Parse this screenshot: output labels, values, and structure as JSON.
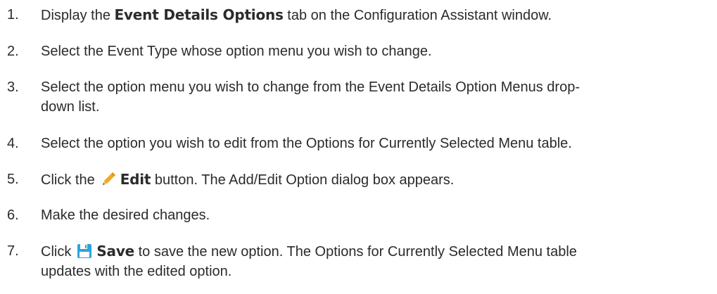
{
  "steps": [
    {
      "number": "1.",
      "before": "Display the ",
      "bold": "Event Details Options",
      "after": " tab on the Configuration Assistant window."
    },
    {
      "number": "2.",
      "text": "Select the Event Type whose option menu you wish to change."
    },
    {
      "number": "3.",
      "line1": "Select the option menu you wish to change from the Event Details Option Menus drop-",
      "line2": "down list."
    },
    {
      "number": "4.",
      "text": "Select the option you wish to edit from the Options for Currently Selected Menu table."
    },
    {
      "number": "5.",
      "before": "Click the",
      "icon": "pencil-icon",
      "bold": "Edit",
      "after": " button. The Add/Edit Option dialog box appears."
    },
    {
      "number": "6.",
      "text": "Make the desired changes."
    },
    {
      "number": "7.",
      "before": "Click",
      "icon": "save-icon",
      "bold": "Save",
      "after_line1": " to save the new option. The Options for Currently Selected Menu table",
      "line2": "updates with the edited option."
    }
  ],
  "colors": {
    "text": "#2b2b2b",
    "pencil": "#f5a623",
    "save": "#2ea3dc"
  }
}
